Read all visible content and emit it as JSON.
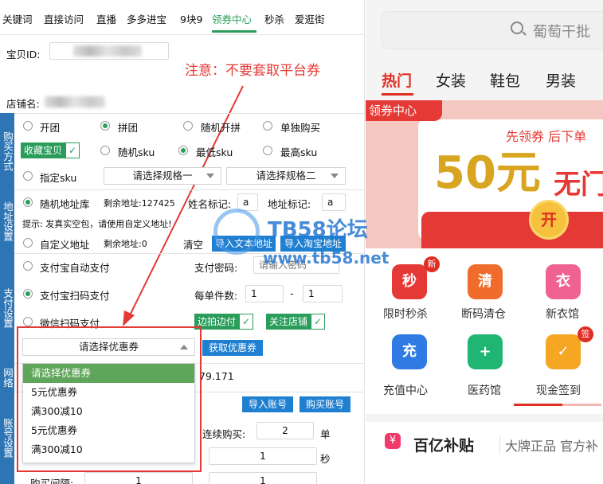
{
  "tabs": [
    "关键词",
    "直接访问",
    "直播",
    "多多进宝",
    "9块9",
    "领券中心",
    "秒杀",
    "爱逛街"
  ],
  "active_tab": "领券中心",
  "shop": {
    "baobei_id_label": "宝贝ID:",
    "shop_name_label": "店铺名:"
  },
  "annotation": {
    "text": "注意：不要套取平台券"
  },
  "purchase": {
    "side_label": "购买方式",
    "types": [
      "开团",
      "拼团",
      "随机开拼",
      "单独购买"
    ],
    "favorite": "收藏宝贝",
    "sku": [
      "随机sku",
      "最低sku",
      "最高sku"
    ],
    "specific_sku": "指定sku",
    "spec1": "请选择规格一",
    "spec2": "请选择规格二"
  },
  "address": {
    "side_label": "地址设置",
    "random_lib": "随机地址库",
    "remain1": "剩余地址:127425",
    "name_mark_label": "姓名标记:",
    "name_mark_value": "a",
    "addr_mark_label": "地址标记:",
    "addr_mark_value": "a",
    "tip": "提示: 发真实空包，请使用自定义地址!",
    "custom": "自定义地址",
    "remain2": "剩余地址:0",
    "clear": "清空",
    "import_text": "导入文本地址",
    "import_taobao": "导入淘宝地址"
  },
  "payment": {
    "side_label": "支付设置",
    "alipay_auto": "支付宝自动支付",
    "alipay_qr": "支付宝扫码支付",
    "wechat_qr": "微信扫码支付",
    "pwd_label": "支付密码:",
    "pwd_placeholder": "请输入密码",
    "per_qty_label": "每单件数:",
    "per_qty_min": "1",
    "dash": "-",
    "per_qty_max": "1",
    "pay_while_shoot": "边拍边付",
    "follow_shop": "关注店铺",
    "coupon_select": "请选择优惠券",
    "get_coupon": "获取优惠券"
  },
  "coupon_options": [
    "请选择优惠券",
    "5元优惠券",
    "满300减10",
    "5元优惠券",
    "满300减10"
  ],
  "network": {
    "side_label": "网络",
    "ip_tail": "79.171"
  },
  "account": {
    "side_label": "账号设置",
    "import_account": "导入账号",
    "buy_account": "购买账号",
    "continuous_label": "连续购买:",
    "continuous_value": "2",
    "unit_dan": "单",
    "range1_min": "1",
    "unit_sec": "秒",
    "interval_label": "购买间隔:",
    "interval_min": "1",
    "interval_max": "1"
  },
  "right": {
    "search_placeholder": "葡萄干批",
    "categories": [
      "热门",
      "女装",
      "鞋包",
      "男装"
    ],
    "banner_tag": "领券中心",
    "banner_line": "先领券 后下单",
    "banner_big": "50元",
    "banner_sub": "无门",
    "banner_open": "开",
    "grid": [
      {
        "label": "限时秒杀",
        "glyph": "秒",
        "color": "#e53935",
        "badge": "新"
      },
      {
        "label": "断码清仓",
        "glyph": "清",
        "color": "#ef6c2c",
        "badge": ""
      },
      {
        "label": "新衣馆",
        "glyph": "衣",
        "color": "#f06292",
        "badge": ""
      },
      {
        "label": "充值中心",
        "glyph": "充",
        "color": "#2f7be3",
        "badge": ""
      },
      {
        "label": "医药馆",
        "glyph": "+",
        "color": "#1fb572",
        "badge": ""
      },
      {
        "label": "现金签到",
        "glyph": "✓",
        "color": "#f5a623",
        "badge": "签"
      }
    ],
    "progress_fraction": 0.55,
    "subsidy_title": "百亿补贴",
    "subsidy_sub": "大牌正品 官方补",
    "subsidy_icon": "¥"
  },
  "watermark": {
    "brand": "TB58论坛",
    "url": "www.tb58.net"
  }
}
